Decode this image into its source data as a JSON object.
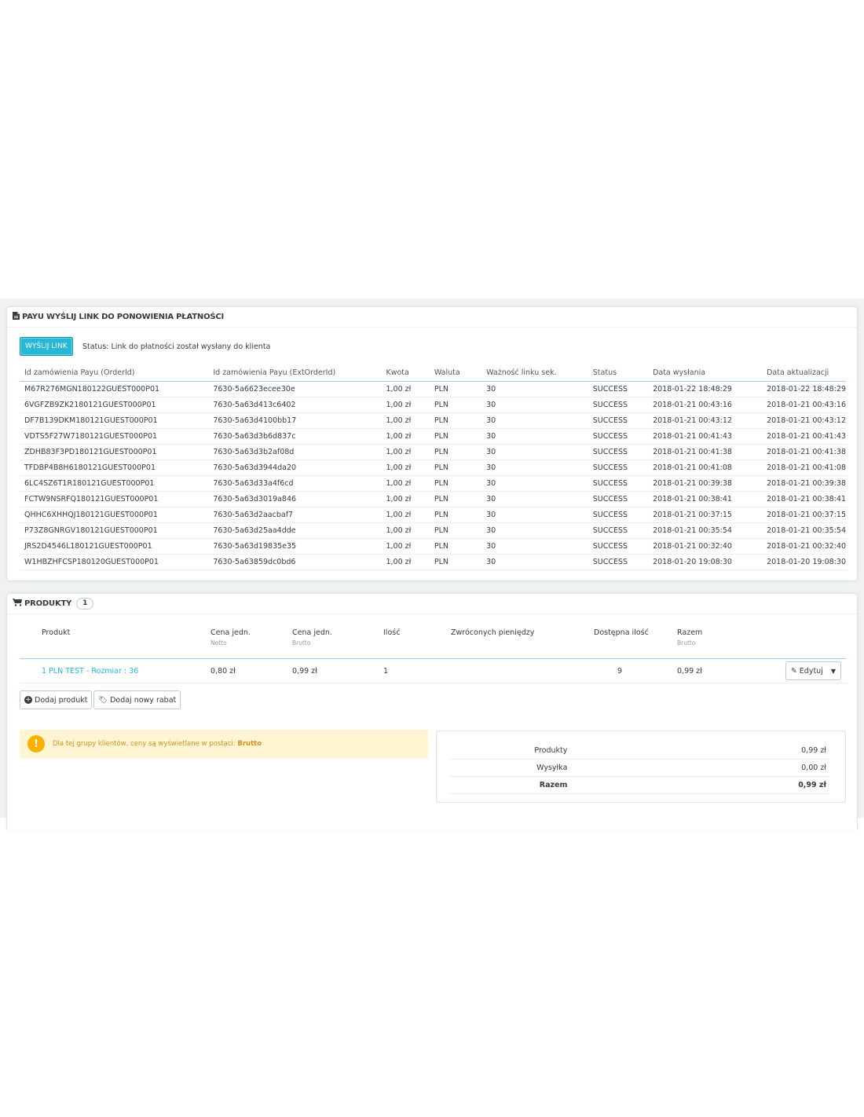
{
  "payu_panel": {
    "title": "PAYU WYŚLIJ LINK DO PONOWIENIA PŁATNOŚCI",
    "send_button": "WYŚLIJ LINK",
    "status_text": "Status: Link do płatności został wysłany do klienta",
    "columns": [
      "Id zamówienia Payu (OrderId)",
      "Id zamówienia Payu (ExtOrderId)",
      "Kwota",
      "Waluta",
      "Ważność linku sek.",
      "Status",
      "Data wysłania",
      "Data aktualizacji"
    ],
    "rows": [
      [
        "M67R276MGN180122GUEST000P01",
        "7630-5a6623ecee30e",
        "1,00 zł",
        "PLN",
        "30",
        "SUCCESS",
        "2018-01-22 18:48:29",
        "2018-01-22 18:48:29"
      ],
      [
        "6VGFZB9ZK2180121GUEST000P01",
        "7630-5a63d413c6402",
        "1,00 zł",
        "PLN",
        "30",
        "SUCCESS",
        "2018-01-21 00:43:16",
        "2018-01-21 00:43:16"
      ],
      [
        "DF7B139DKM180121GUEST000P01",
        "7630-5a63d4100bb17",
        "1,00 zł",
        "PLN",
        "30",
        "SUCCESS",
        "2018-01-21 00:43:12",
        "2018-01-21 00:43:12"
      ],
      [
        "VDTS5F27W7180121GUEST000P01",
        "7630-5a63d3b6d837c",
        "1,00 zł",
        "PLN",
        "30",
        "SUCCESS",
        "2018-01-21 00:41:43",
        "2018-01-21 00:41:43"
      ],
      [
        "ZDHB83F3PD180121GUEST000P01",
        "7630-5a63d3b2af08d",
        "1,00 zł",
        "PLN",
        "30",
        "SUCCESS",
        "2018-01-21 00:41:38",
        "2018-01-21 00:41:38"
      ],
      [
        "TFDBP4B8H6180121GUEST000P01",
        "7630-5a63d3944da20",
        "1,00 zł",
        "PLN",
        "30",
        "SUCCESS",
        "2018-01-21 00:41:08",
        "2018-01-21 00:41:08"
      ],
      [
        "6LC4SZ6T1R180121GUEST000P01",
        "7630-5a63d33a4f6cd",
        "1,00 zł",
        "PLN",
        "30",
        "SUCCESS",
        "2018-01-21 00:39:38",
        "2018-01-21 00:39:38"
      ],
      [
        "FCTW9NSRFQ180121GUEST000P01",
        "7630-5a63d3019a846",
        "1,00 zł",
        "PLN",
        "30",
        "SUCCESS",
        "2018-01-21 00:38:41",
        "2018-01-21 00:38:41"
      ],
      [
        "QHHC6XHHQJ180121GUEST000P01",
        "7630-5a63d2aacbaf7",
        "1,00 zł",
        "PLN",
        "30",
        "SUCCESS",
        "2018-01-21 00:37:15",
        "2018-01-21 00:37:15"
      ],
      [
        "P73Z8GNRGV180121GUEST000P01",
        "7630-5a63d25aa4dde",
        "1,00 zł",
        "PLN",
        "30",
        "SUCCESS",
        "2018-01-21 00:35:54",
        "2018-01-21 00:35:54"
      ],
      [
        "JRS2D4546L180121GUEST000P01",
        "7630-5a63d19835e35",
        "1,00 zł",
        "PLN",
        "30",
        "SUCCESS",
        "2018-01-21 00:32:40",
        "2018-01-21 00:32:40"
      ],
      [
        "W1HBZHFCSP180120GUEST000P01",
        "7630-5a63859dc0bd6",
        "1,00 zł",
        "PLN",
        "30",
        "SUCCESS",
        "2018-01-20 19:08:30",
        "2018-01-20 19:08:30"
      ]
    ]
  },
  "products_panel": {
    "title": "PRODUKTY",
    "count": "1",
    "columns": [
      {
        "label": "Produkt",
        "sub": ""
      },
      {
        "label": "Cena jedn.",
        "sub": "Netto"
      },
      {
        "label": "Cena jedn.",
        "sub": "Brutto"
      },
      {
        "label": "Ilość",
        "sub": ""
      },
      {
        "label": "Zwróconych pieniędzy",
        "sub": ""
      },
      {
        "label": "Dostępna ilość",
        "sub": ""
      },
      {
        "label": "Razem",
        "sub": "Brutto"
      }
    ],
    "product": {
      "name": "1 PLN TEST - Rozmiar : 36",
      "unit_net": "0,80 zł",
      "unit_gross": "0,99 zł",
      "qty": "1",
      "refunded": "",
      "available": "9",
      "total": "0,99 zł",
      "edit_label": "Edytuj"
    },
    "add_product_label": "Dodaj produkt",
    "add_discount_label": "Dodaj nowy rabat",
    "alert": {
      "text": "Dla tej grupy klientów, ceny są wyświetlane w postaci: ",
      "strong": "Brutto"
    },
    "summary": [
      {
        "label": "Produkty",
        "value": "0,99 zł",
        "bold": false
      },
      {
        "label": "Wysyłka",
        "value": "0,00 zł",
        "bold": false
      },
      {
        "label": "Razem",
        "value": "0,99 zł",
        "bold": true
      }
    ]
  }
}
